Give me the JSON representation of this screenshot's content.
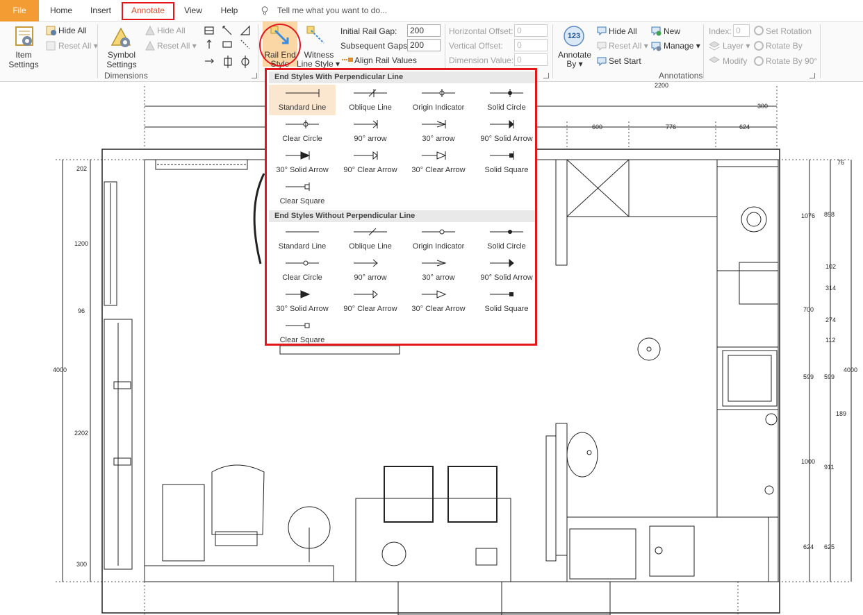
{
  "menu": {
    "file": "File",
    "home": "Home",
    "insert": "Insert",
    "annotate": "Annotate",
    "view": "View",
    "help": "Help",
    "tellme": "Tell me what you want to do..."
  },
  "ribbon": {
    "item_settings": "Item\nSettings",
    "hide_all": "Hide All",
    "reset_all": "Reset All",
    "symbol_settings": "Symbol\nSettings",
    "hide_all_2": "Hide All",
    "reset_all_2": "Reset All",
    "dimensions_group": "Dimensions",
    "rail_end_style_1": "Rail End",
    "rail_end_style_2": "Style",
    "witness_1": "Witness",
    "witness_2": "Line Style",
    "initial_rail_gap": "Initial Rail Gap:",
    "initial_rail_gap_value": "200",
    "subsequent_gaps": "Subsequent Gaps:",
    "subsequent_gaps_value": "200",
    "align_rail_values": "Align Rail Values",
    "horizontal_offset": "Horizontal Offset:",
    "horizontal_offset_value": "0",
    "vertical_offset": "Vertical Offset:",
    "vertical_offset_value": "0",
    "dimension_value": "Dimension Value:",
    "dimension_value_value": "0",
    "annotate_by_1": "Annotate",
    "annotate_by_2": "By",
    "annotate_icon": "123",
    "hide_all_3": "Hide All",
    "reset_all_3": "Reset All",
    "set_start": "Set Start",
    "new": "New",
    "manage": "Manage",
    "annotations_group": "Annotations",
    "index": "Index:",
    "index_value": "0",
    "layer": "Layer",
    "modify": "Modify",
    "set_rotation": "Set Rotation",
    "rotate_by": "Rotate By",
    "rotate_by_90": "Rotate By 90°"
  },
  "dropdown": {
    "section1": "End Styles With Perpendicular Line",
    "section2": "End Styles Without Perpendicular Line",
    "with_perp": [
      {
        "label": "Standard Line",
        "icon": "standard-line"
      },
      {
        "label": "Oblique Line",
        "icon": "oblique-line"
      },
      {
        "label": "Origin Indicator",
        "icon": "origin-indicator"
      },
      {
        "label": "Solid Circle",
        "icon": "solid-circle"
      },
      {
        "label": "Clear Circle",
        "icon": "clear-circle"
      },
      {
        "label": "90° arrow",
        "icon": "arrow-90"
      },
      {
        "label": "30° arrow",
        "icon": "arrow-30"
      },
      {
        "label": "90° Solid Arrow",
        "icon": "solid-arrow-90"
      },
      {
        "label": "30° Solid Arrow",
        "icon": "solid-arrow-30"
      },
      {
        "label": "90° Clear Arrow",
        "icon": "clear-arrow-90"
      },
      {
        "label": "30° Clear Arrow",
        "icon": "clear-arrow-30"
      },
      {
        "label": "Solid Square",
        "icon": "solid-square"
      },
      {
        "label": "Clear Square",
        "icon": "clear-square"
      }
    ],
    "without_perp": [
      {
        "label": "Standard Line",
        "icon": "standard-line"
      },
      {
        "label": "Oblique Line",
        "icon": "oblique-line"
      },
      {
        "label": "Origin Indicator",
        "icon": "origin-indicator"
      },
      {
        "label": "Solid Circle",
        "icon": "solid-circle"
      },
      {
        "label": "Clear Circle",
        "icon": "clear-circle"
      },
      {
        "label": "90° arrow",
        "icon": "arrow-90"
      },
      {
        "label": "30° arrow",
        "icon": "arrow-30"
      },
      {
        "label": "90° Solid Arrow",
        "icon": "solid-arrow-90"
      },
      {
        "label": "30° Solid Arrow",
        "icon": "solid-arrow-30"
      },
      {
        "label": "90° Clear Arrow",
        "icon": "clear-arrow-90"
      },
      {
        "label": "30° Clear Arrow",
        "icon": "clear-arrow-30"
      },
      {
        "label": "Solid Square",
        "icon": "solid-square"
      },
      {
        "label": "Clear Square",
        "icon": "clear-square"
      }
    ]
  },
  "plan": {
    "top_dims": [
      "2200",
      "300",
      "600",
      "776",
      "624"
    ],
    "left_dims": [
      "202",
      "1200",
      "96",
      "4000",
      "2202",
      "300"
    ],
    "right_inner_dims": [
      "1076",
      "700",
      "599",
      "1000",
      "624"
    ],
    "right_mid_dims": [
      "76",
      "898",
      "102",
      "314",
      "274",
      "112",
      "599",
      "189",
      "911",
      "625"
    ],
    "right_outer_dims": [
      "4000"
    ]
  },
  "colors": {
    "accent": "#f39c34",
    "highlight": "#e2161b",
    "selected": "#fbd7a6"
  }
}
